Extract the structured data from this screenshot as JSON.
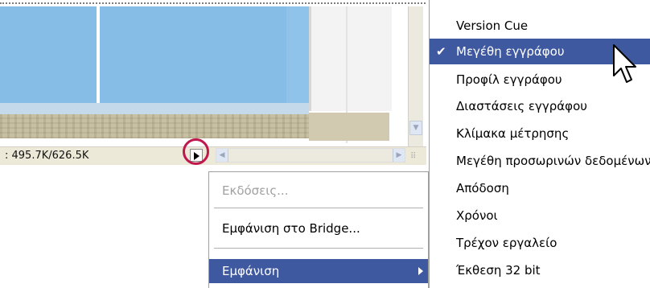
{
  "status_bar": {
    "info_text": ": 495.7K/626.5K"
  },
  "menu_primary": {
    "items": [
      {
        "label": "Εκδόσεις...",
        "enabled": false
      },
      {
        "label": "Εμφάνιση στο Bridge...",
        "enabled": true
      },
      {
        "label": "Εμφάνιση",
        "enabled": true,
        "submenu": true,
        "highlighted": true
      }
    ]
  },
  "menu_show": {
    "items": [
      {
        "label": "Version Cue",
        "checked": false
      },
      {
        "label": "Μεγέθη εγγράφου",
        "checked": true,
        "highlighted": true
      },
      {
        "label": "Προφίλ εγγράφου",
        "checked": false
      },
      {
        "label": "Διαστάσεις εγγράφου",
        "checked": false
      },
      {
        "label": "Κλίμακα μέτρησης",
        "checked": false
      },
      {
        "label": "Μεγέθη προσωρινών δεδομένων",
        "checked": false
      },
      {
        "label": "Απόδοση",
        "checked": false
      },
      {
        "label": "Χρόνοι",
        "checked": false
      },
      {
        "label": "Τρέχον εργαλείο",
        "checked": false
      },
      {
        "label": "Έκθεση 32 bit",
        "checked": false
      }
    ],
    "check_glyph": "✔"
  },
  "colors": {
    "menu_highlight": "#3f59a0",
    "callout_ring": "#c0184d"
  },
  "icons": {
    "status_popup": "triangle-right-icon",
    "pointer": "arrow-pointer-icon",
    "submenu": "chevron-right-icon"
  }
}
